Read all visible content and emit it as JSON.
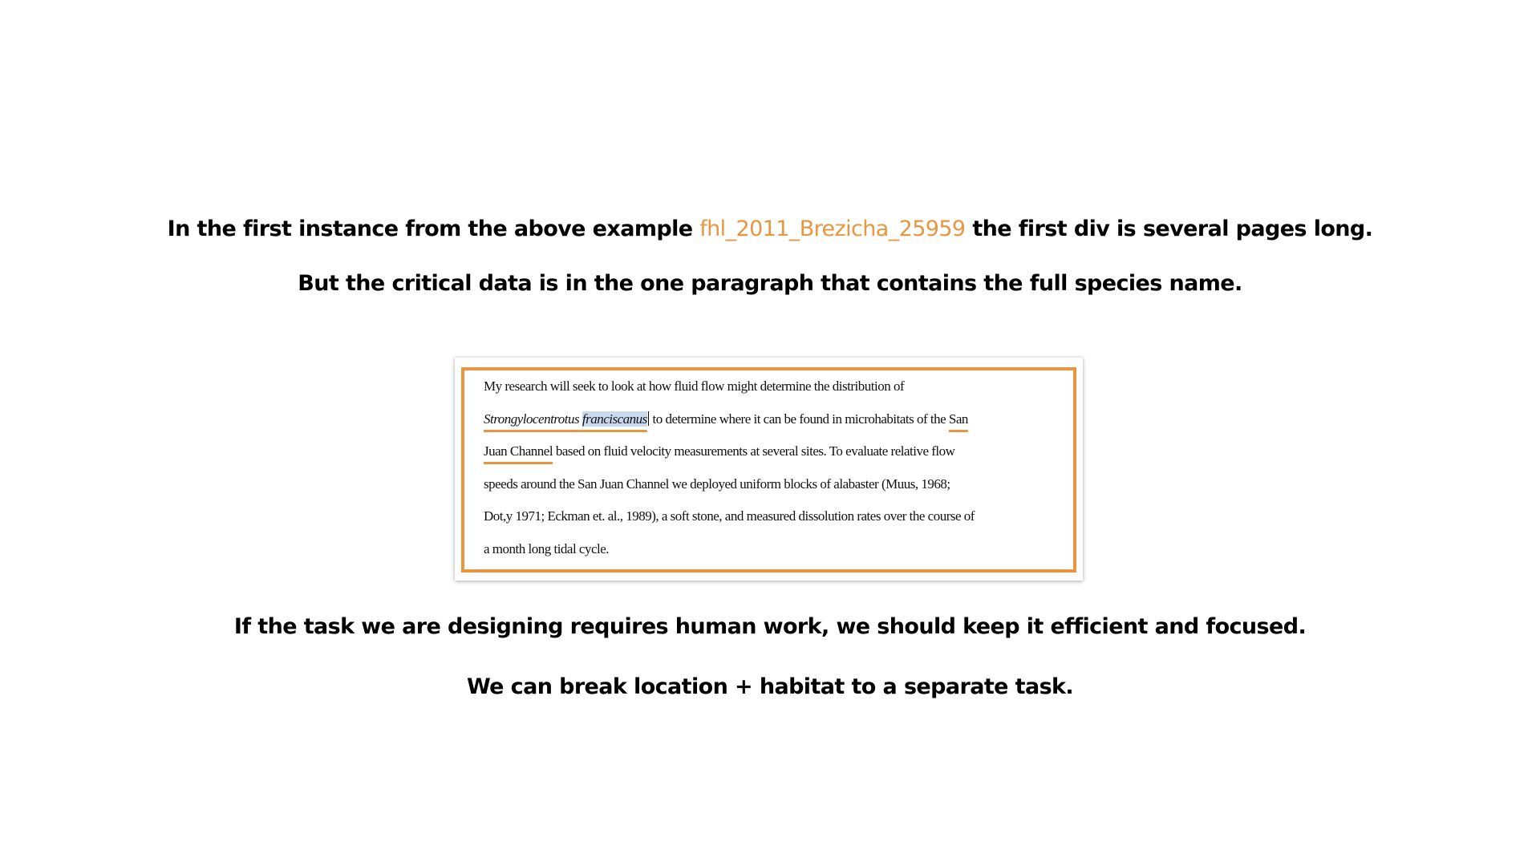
{
  "slide": {
    "line1_before": "In the first instance from the above example ",
    "line1_highlight": "fhl_2011_Brezicha_25959",
    "line1_after": " the first div is several pages long.",
    "line2": "But the critical data is in the one paragraph that contains the full species name.",
    "line3": "If the task we are designing requires human work, we should keep it efficient and focused.",
    "line4": "We can break location + habitat to a separate task."
  },
  "document": {
    "line1": "My research will seek to look at how fluid flow might determine the distribution of",
    "line2_species_genus": "Strongylocentrotus",
    "line2_species_epithet": "franciscanus",
    "line2_rest": " to determine where it can be found in microhabitats of the ",
    "line2_place_start": "San",
    "line3_place_end": "Juan Channel",
    "line3_rest": " based on fluid velocity measurements at several sites. To evaluate relative flow",
    "line4": "speeds around the San Juan Channel we deployed uniform blocks of alabaster (Muus, 1968;",
    "line5": "Dot,y 1971; Eckman et. al., 1989), a soft stone, and measured dissolution rates over the course of",
    "line6": "a month long tidal cycle."
  },
  "colors": {
    "accent": "#e8963f",
    "selection": "#c9d9f0"
  }
}
